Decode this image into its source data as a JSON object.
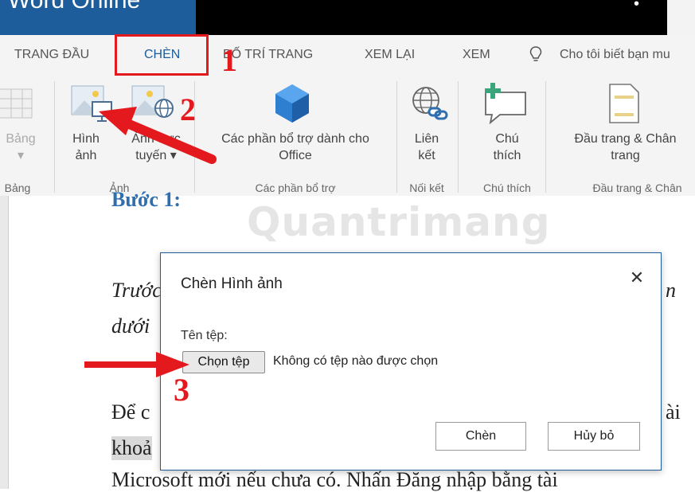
{
  "app": {
    "title": "Word Online"
  },
  "tabs": [
    {
      "label": "TRANG ĐẦU"
    },
    {
      "label": "CHÈN"
    },
    {
      "label": "BỐ TRÍ TRANG"
    },
    {
      "label": "XEM LẠI"
    },
    {
      "label": "XEM"
    }
  ],
  "tell_me": {
    "label": "Cho tôi biết bạn mu"
  },
  "ribbon": {
    "table_button": {
      "line1": "Bảng",
      "line2": "▾"
    },
    "picture_button": {
      "line1": "Hình",
      "line2": "ảnh"
    },
    "online_picture_button": {
      "line1": "Ảnh trực",
      "line2": "tuyến ▾"
    },
    "addins_button": {
      "line1": "Các phần bổ trợ dành cho",
      "line2": "Office"
    },
    "link_button": {
      "line1": "Liên",
      "line2": "kết"
    },
    "comment_button": {
      "line1": "Chú",
      "line2": "thích"
    },
    "header_footer_button": {
      "line1": "Đầu trang & Chân",
      "line2": "trang"
    },
    "groups": {
      "tables": "Bảng",
      "pictures": "Ảnh",
      "addins": "Các phần bổ trợ",
      "links": "Nối kết",
      "comments": "Chú thích",
      "header_footer": "Đầu trang & Chân"
    }
  },
  "document": {
    "heading": "Bước 1:",
    "line1": "Trước",
    "line1_tail": "n",
    "line2": "dưới",
    "line3": "Để c",
    "line3_tail": "ài",
    "line4": "khoả",
    "line5": "Microsoft mới nếu chưa có. Nhấn Đăng nhập bằng tài"
  },
  "watermark": "Quantrimang",
  "dialog": {
    "title": "Chèn Hình ảnh",
    "file_label": "Tên tệp:",
    "choose_button": "Chọn tệp",
    "file_status": "Không có tệp nào được chọn",
    "insert_button": "Chèn",
    "cancel_button": "Hủy bỏ"
  },
  "annotations": {
    "step1": "1",
    "step2": "2",
    "step3": "3"
  },
  "colors": {
    "accent": "#1e5d9b",
    "highlight": "#e3191e"
  }
}
